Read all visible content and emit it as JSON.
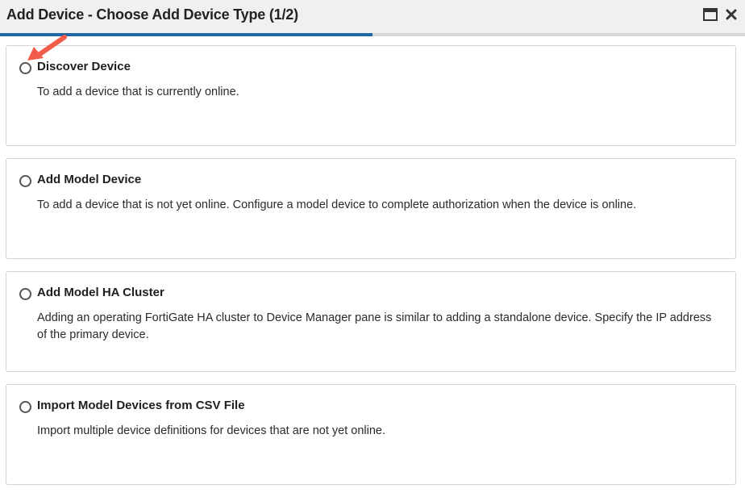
{
  "window": {
    "title": "Add Device - Choose Add Device Type (1/2)",
    "maximize_icon": "maximize-icon",
    "close_icon": "close-icon",
    "progress_fraction": 0.5
  },
  "options": [
    {
      "title": "Discover Device",
      "description": "To add a device that is currently online.",
      "selected": false
    },
    {
      "title": "Add Model Device",
      "description": "To add a device that is not yet online. Configure a model device to complete authorization when the device is online.",
      "selected": false
    },
    {
      "title": "Add Model HA Cluster",
      "description": "Adding an operating FortiGate HA cluster to Device Manager pane is similar to adding a standalone device. Specify the IP address of the primary device.",
      "selected": false
    },
    {
      "title": "Import Model Devices from CSV File",
      "description": "Import multiple device definitions for devices that are not yet online.",
      "selected": false
    }
  ],
  "colors": {
    "progress": "#1e67a6",
    "annotation_arrow": "#f25c4a"
  }
}
